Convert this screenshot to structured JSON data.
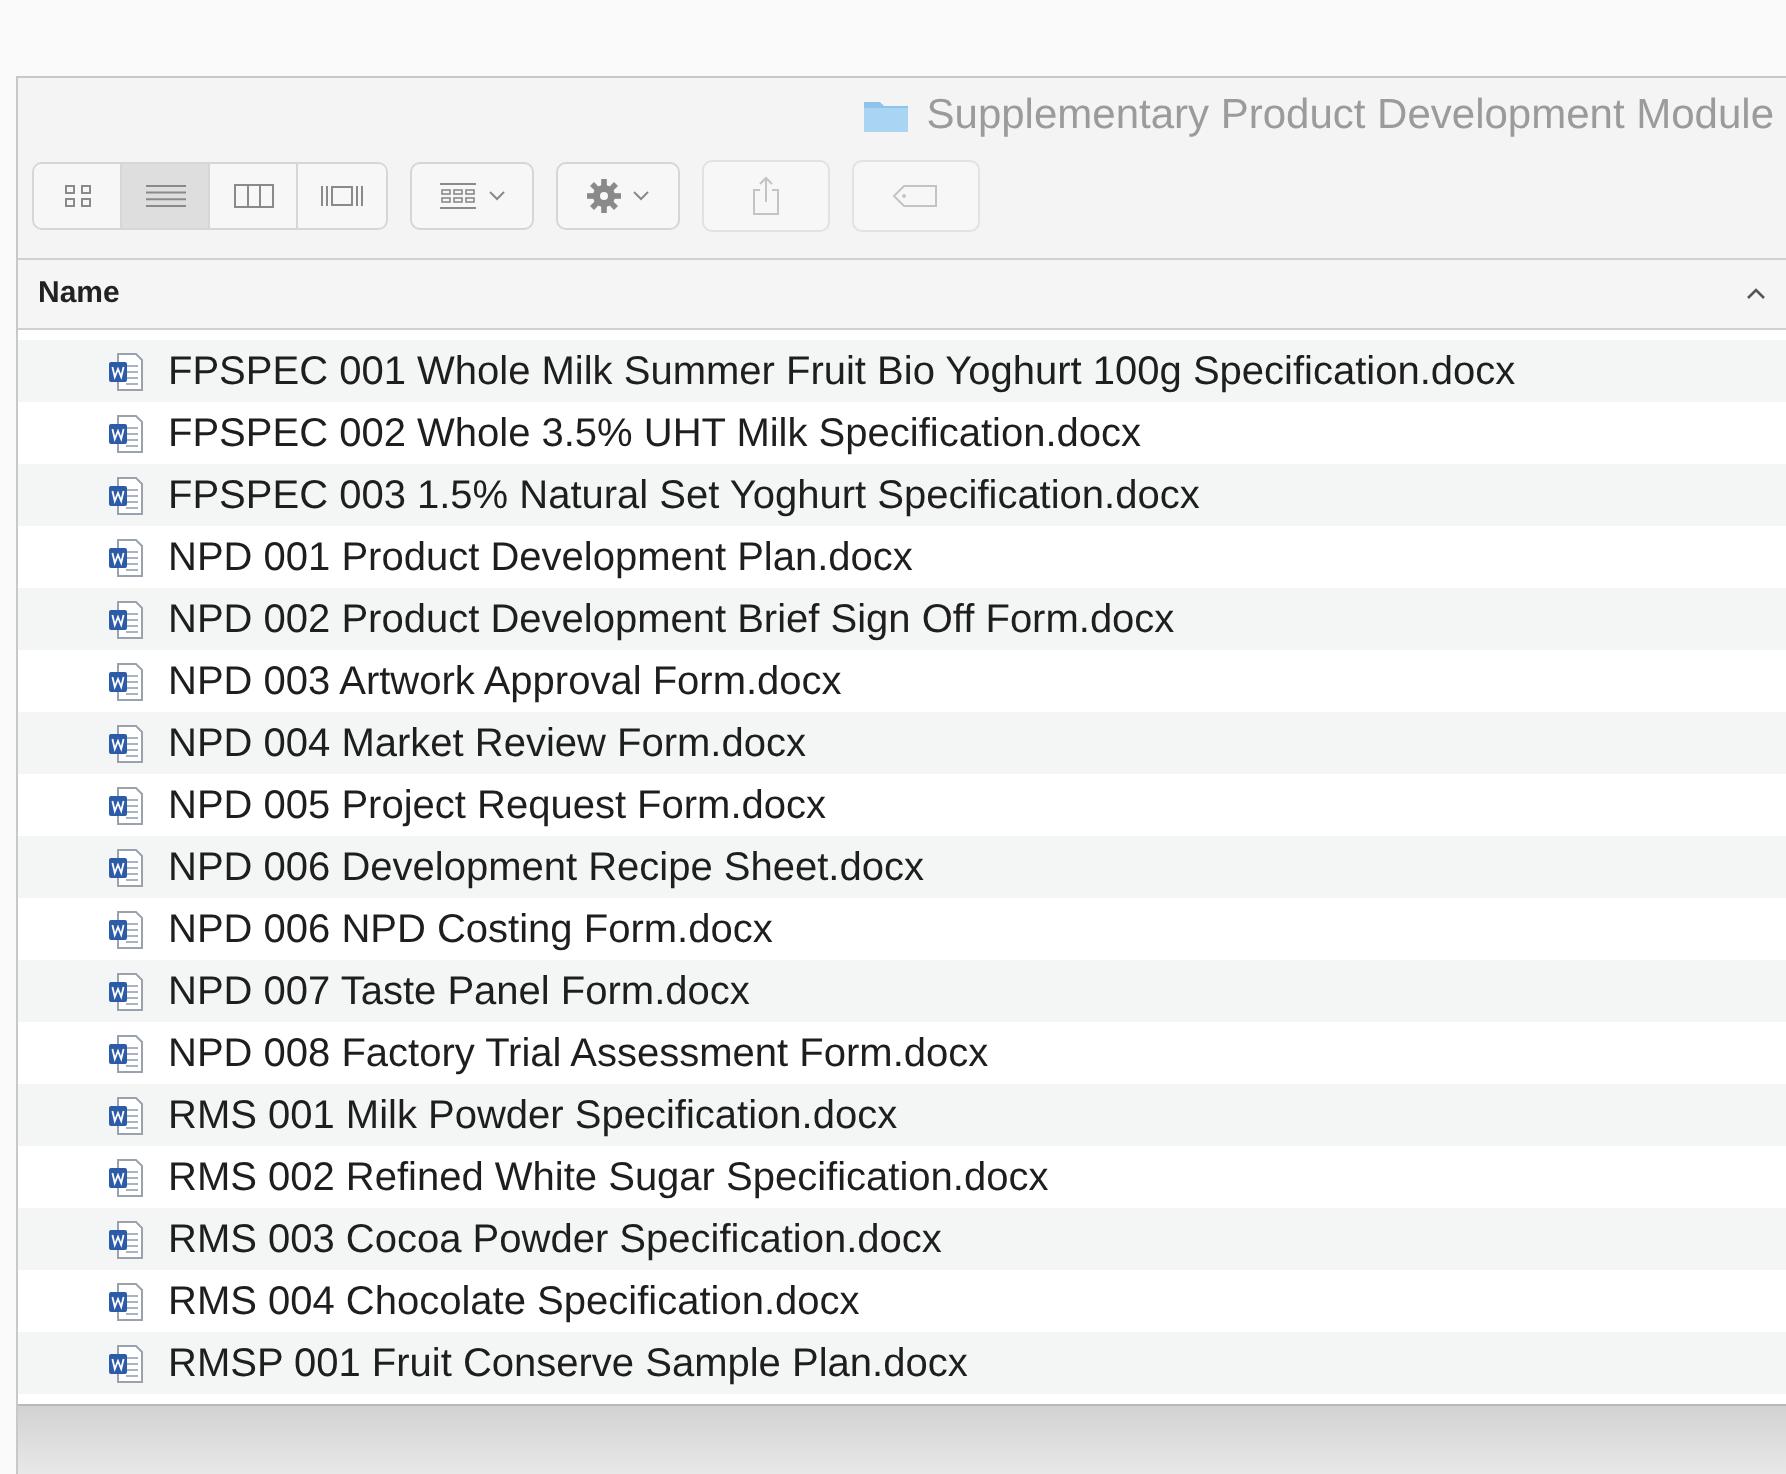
{
  "window": {
    "title": "Supplementary Product Development Module"
  },
  "toolbar": {
    "view_modes": [
      {
        "kind": "icons",
        "selected": false
      },
      {
        "kind": "list",
        "selected": true
      },
      {
        "kind": "columns",
        "selected": false
      },
      {
        "kind": "gallery",
        "selected": false
      }
    ]
  },
  "table": {
    "columns": [
      {
        "label": "Name",
        "sort_ascending": true
      }
    ],
    "rows": [
      {
        "name": "FPSPEC 001 Whole Milk Summer Fruit Bio Yoghurt 100g Specification.docx"
      },
      {
        "name": "FPSPEC 002 Whole 3.5% UHT Milk Specification.docx"
      },
      {
        "name": "FPSPEC 003 1.5% Natural Set Yoghurt Specification.docx"
      },
      {
        "name": "NPD 001 Product Development Plan.docx"
      },
      {
        "name": "NPD 002 Product Development Brief Sign Off Form.docx"
      },
      {
        "name": "NPD 003 Artwork Approval Form.docx"
      },
      {
        "name": "NPD 004 Market Review Form.docx"
      },
      {
        "name": "NPD 005 Project Request Form.docx"
      },
      {
        "name": "NPD 006 Development Recipe Sheet.docx"
      },
      {
        "name": "NPD 006 NPD Costing Form.docx"
      },
      {
        "name": "NPD 007 Taste Panel Form.docx"
      },
      {
        "name": "NPD 008 Factory Trial Assessment Form.docx"
      },
      {
        "name": "RMS 001 Milk Powder Specification.docx"
      },
      {
        "name": "RMS 002 Refined White Sugar Specification.docx"
      },
      {
        "name": "RMS 003 Cocoa Powder Specification.docx"
      },
      {
        "name": "RMS 004 Chocolate Specification.docx"
      },
      {
        "name": "RMSP 001 Fruit Conserve Sample Plan.docx"
      }
    ]
  }
}
